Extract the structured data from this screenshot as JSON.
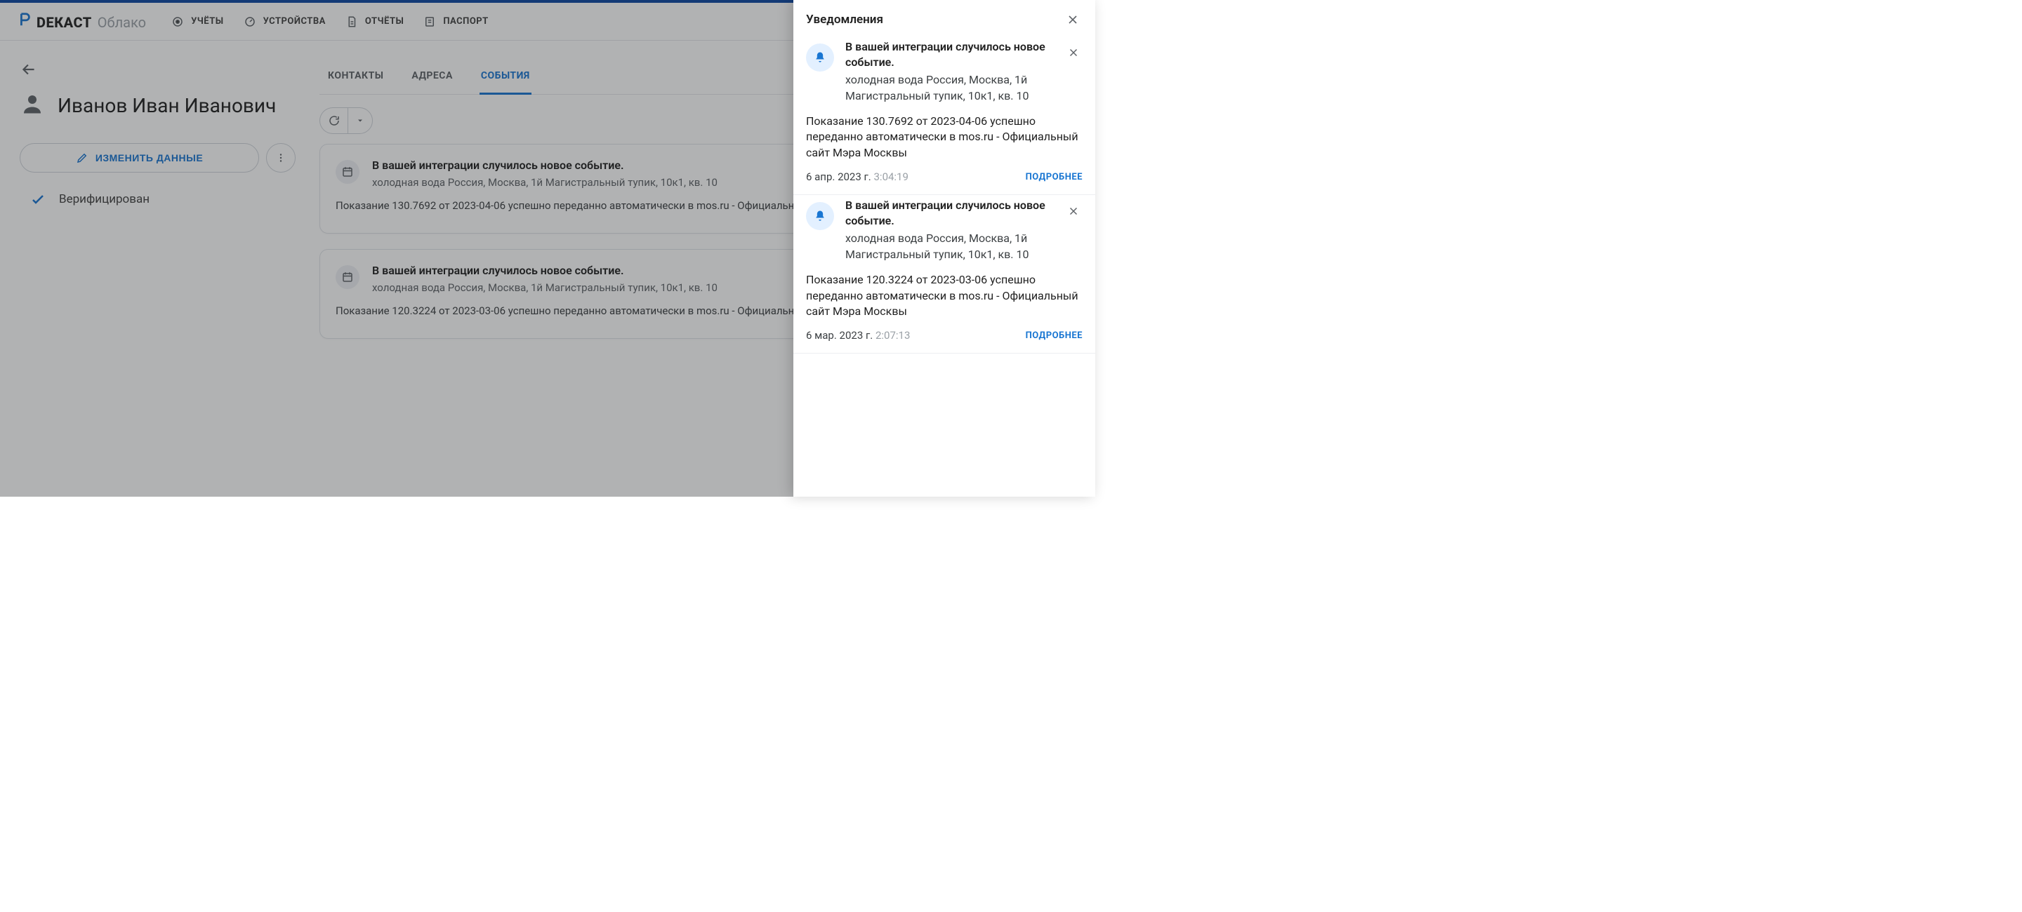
{
  "brand": {
    "name": "DЕКАСТ",
    "sub": "Облако"
  },
  "nav": [
    {
      "label": "УЧЁТЫ"
    },
    {
      "label": "УСТРОЙСТВА"
    },
    {
      "label": "ОТЧЁТЫ"
    },
    {
      "label": "ПАСПОРТ"
    }
  ],
  "person": {
    "name": "Иванов Иван Иванович",
    "edit_label": "ИЗМЕНИТЬ ДАННЫЕ",
    "verified_label": "Верифицирован"
  },
  "tabs": [
    {
      "label": "КОНТАКТЫ"
    },
    {
      "label": "АДРЕСА"
    },
    {
      "label": "СОБЫТИЯ"
    }
  ],
  "events": [
    {
      "title": "В вашей интеграции случилось новое событие.",
      "sub": "холодная вода Россия, Москва, 1й Магистральный тупик, 10к1, кв. 10",
      "body": "Показание 130.7692 от 2023-04-06 успешно переданно автоматически в mos.ru - Официальн"
    },
    {
      "title": "В вашей интеграции случилось новое событие.",
      "sub": "холодная вода Россия, Москва, 1й Магистральный тупик, 10к1, кв. 10",
      "body": "Показание 120.3224 от 2023-03-06 успешно переданно автоматически в mos.ru - Официальн"
    }
  ],
  "panel": {
    "title": "Уведомления",
    "more_label": "ПОДРОБНЕЕ",
    "items": [
      {
        "title": "В вашей интеграции случилось новое событие.",
        "sub": "холодная вода Россия, Москва, 1й Магистральный тупик, 10к1, кв. 10",
        "desc": "Показание 130.7692 от 2023-04-06 успешно переданно автоматически в mos.ru - Официальный сайт Мэра Москвы",
        "date": "6 апр. 2023 г.",
        "time": "3:04:19"
      },
      {
        "title": "В вашей интеграции случилось новое событие.",
        "sub": "холодная вода Россия, Москва, 1й Магистральный тупик, 10к1, кв. 10",
        "desc": "Показание 120.3224 от 2023-03-06 успешно переданно автоматически в mos.ru - Официальный сайт Мэра Москвы",
        "date": "6 мар. 2023 г.",
        "time": "2:07:13"
      }
    ]
  }
}
